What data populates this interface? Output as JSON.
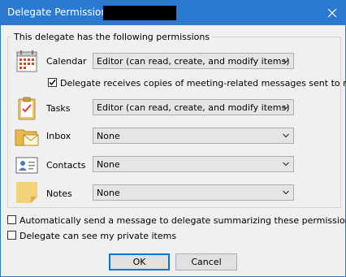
{
  "dialog": {
    "title": "Delegate Permissions:",
    "close_icon": "close-icon"
  },
  "group": {
    "label": "This delegate has the following permissions"
  },
  "permissions": [
    {
      "label": "Calendar",
      "value": "Editor (can read, create, and modify items)",
      "icon": "calendar-icon"
    },
    {
      "label": "Tasks",
      "value": "Editor (can read, create, and modify items)",
      "icon": "tasks-icon"
    },
    {
      "label": "Inbox",
      "value": "None",
      "icon": "inbox-icon"
    },
    {
      "label": "Contacts",
      "value": "None",
      "icon": "contacts-icon"
    },
    {
      "label": "Notes",
      "value": "None",
      "icon": "notes-icon"
    }
  ],
  "meeting_copy": {
    "label": "Delegate receives copies of meeting-related messages sent to me",
    "checked": true
  },
  "auto_send": {
    "label": "Automatically send a message to delegate summarizing these permissions",
    "checked": false
  },
  "private_items": {
    "label": "Delegate can see my private items",
    "checked": false
  },
  "buttons": {
    "ok": "OK",
    "cancel": "Cancel"
  },
  "colors": {
    "titlebar": "#2b79d0",
    "default_button_border": "#0078d7"
  }
}
